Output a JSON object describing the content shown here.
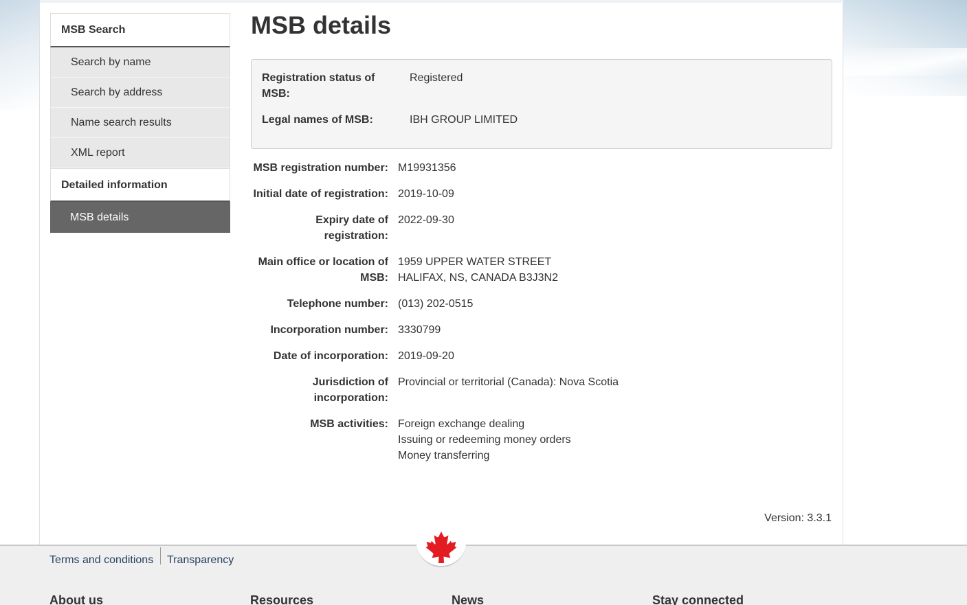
{
  "sidebar": {
    "section1_title": "MSB Search",
    "items": [
      {
        "label": "Search by name"
      },
      {
        "label": "Search by address"
      },
      {
        "label": "Name search results"
      },
      {
        "label": "XML report"
      }
    ],
    "section2_title": "Detailed information",
    "active_item": "MSB details"
  },
  "main": {
    "title": "MSB details",
    "summary": {
      "status_label": "Registration status of MSB:",
      "status_value": "Registered",
      "legal_label": "Legal names of MSB:",
      "legal_value": "IBH GROUP LIMITED"
    },
    "details": {
      "reg_number_label": "MSB registration number:",
      "reg_number_value": "M19931356",
      "initial_date_label": "Initial date of registration:",
      "initial_date_value": "2019-10-09",
      "expiry_label_1": "Expiry date of",
      "expiry_label_2": "registration:",
      "expiry_value": "2022-09-30",
      "office_label_1": "Main office or location of",
      "office_label_2": "MSB:",
      "office_line1": "1959 UPPER WATER STREET",
      "office_line2": "HALIFAX, NS, CANADA B3J3N2",
      "phone_label": "Telephone number:",
      "phone_value": "(013) 202-0515",
      "incorp_number_label": "Incorporation number:",
      "incorp_number_value": "3330799",
      "incorp_date_label": "Date of incorporation:",
      "incorp_date_value": "2019-09-20",
      "jurisdiction_label_1": "Jurisdiction of",
      "jurisdiction_label_2": "incorporation:",
      "jurisdiction_value": "Provincial or territorial (Canada): Nova Scotia",
      "activities_label": "MSB activities:",
      "activities": [
        "Foreign exchange dealing",
        "Issuing or redeeming money orders",
        "Money transferring"
      ]
    },
    "version": "Version: 3.3.1"
  },
  "footer": {
    "terms": "Terms and conditions",
    "transparency": "Transparency",
    "columns": [
      "About us",
      "Resources",
      "News",
      "Stay connected"
    ]
  },
  "colors": {
    "active_nav": "#666666",
    "footer_link": "#284162",
    "leaf_red": "#e31b23"
  }
}
